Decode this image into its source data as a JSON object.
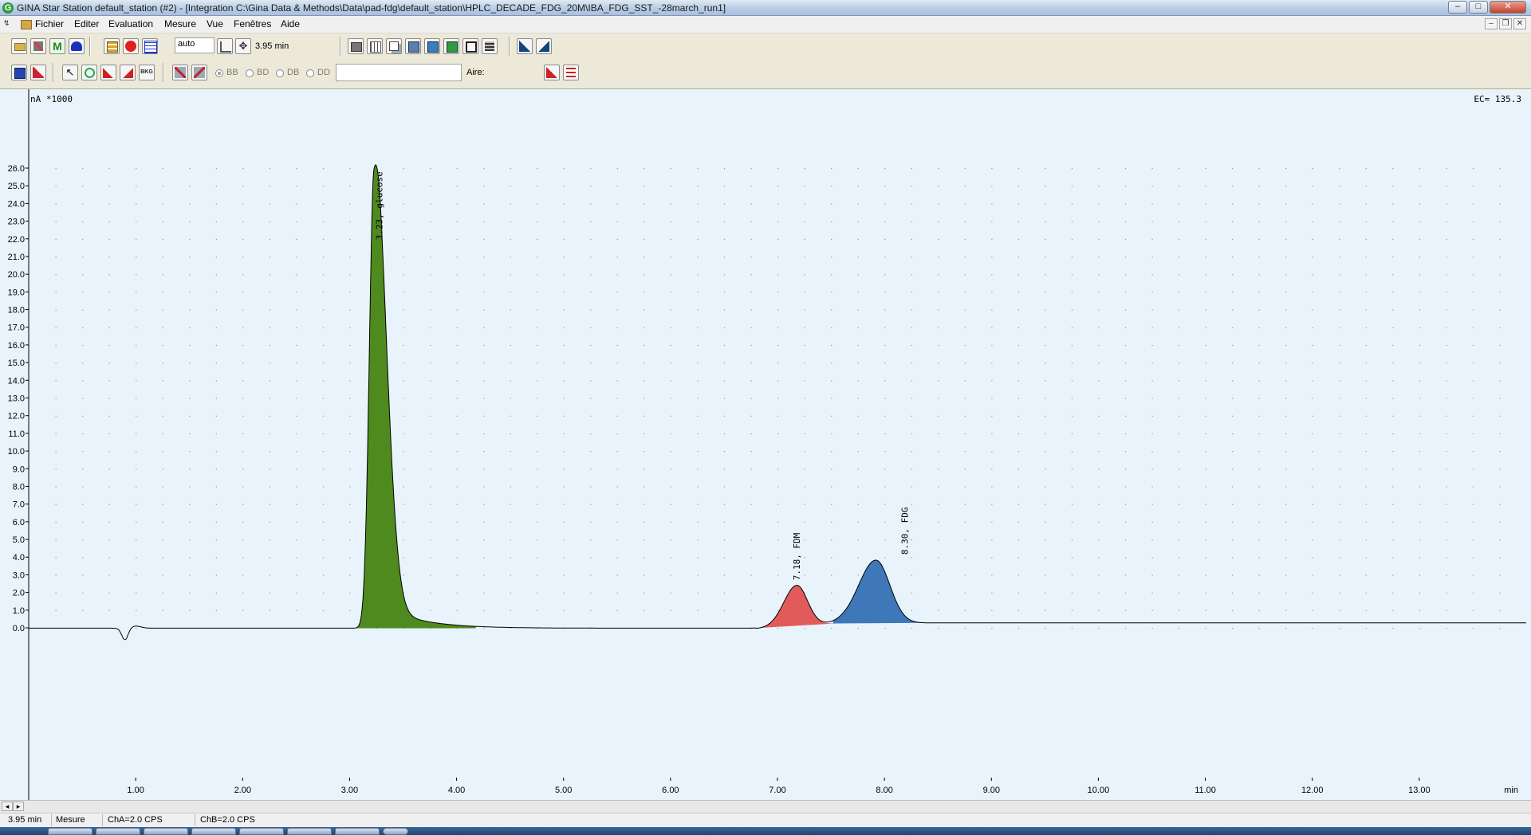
{
  "window": {
    "title": "GINA Star Station default_station (#2) - [Integration C:\\Gina Data & Methods\\Data\\pad-fdg\\default_station\\HPLC_DECADE_FDG_20M\\IBA_FDG_SST_-28march_run1]",
    "app_icon_letter": "G",
    "minimize": "–",
    "maximize": "□",
    "close": "✕"
  },
  "menu": {
    "items": [
      "Fichier",
      "Editer",
      "Evaluation",
      "Mesure",
      "Vue",
      "Fenêtres",
      "Aide"
    ],
    "mdi_minimize": "–",
    "mdi_restore": "❐",
    "mdi_close": "✕"
  },
  "toolbar": {
    "auto_value": "auto",
    "time_readout": "3.95 min",
    "radio_options": [
      "BB",
      "BD",
      "DB",
      "DD"
    ],
    "selected_radio": "BB",
    "area_label": "Aire:",
    "m_button_letter": "M",
    "bkg_label": "BKG"
  },
  "plot": {
    "y_unit": "nA *1000",
    "ec_readout": "EC= 135.3",
    "x_unit": "min",
    "background": "#e9f3fb"
  },
  "chart_data": {
    "type": "line",
    "title": "",
    "xlabel": "min",
    "ylabel": "nA *1000",
    "xlim": [
      0,
      14
    ],
    "ylim": [
      0,
      26
    ],
    "x_ticks": [
      "1.00",
      "2.00",
      "3.00",
      "4.00",
      "5.00",
      "6.00",
      "7.00",
      "8.00",
      "9.00",
      "10.00",
      "11.00",
      "12.00",
      "13.00"
    ],
    "y_ticks": [
      "0.0",
      "1.0",
      "2.0",
      "3.0",
      "4.0",
      "5.0",
      "6.0",
      "7.0",
      "8.0",
      "9.0",
      "10.0",
      "11.0",
      "12.0",
      "13.0",
      "14.0",
      "15.0",
      "16.0",
      "17.0",
      "18.0",
      "19.0",
      "20.0",
      "21.0",
      "22.0",
      "23.0",
      "24.0",
      "25.0",
      "26.0"
    ],
    "grid": true,
    "peaks": [
      {
        "label": "3.23, glucose",
        "rt": 3.23,
        "height": 26.0,
        "color": "#4f8a1e"
      },
      {
        "label": "7.18, FDM",
        "rt": 7.18,
        "height": 2.3,
        "color": "#e25b5b"
      },
      {
        "label": "8.30, FDG",
        "rt": 7.92,
        "height": 3.55,
        "color": "#3f78b8"
      }
    ],
    "trace_color": "#000000",
    "dip": {
      "x": 0.9,
      "y": -0.65
    }
  },
  "statusbar": {
    "time": "3.95 min",
    "mode": "Mesure",
    "cha": "ChA=2.0 CPS",
    "chb": "ChB=2.0 CPS"
  },
  "scrollbar": {
    "left_arrow": "◂",
    "right_arrow": "▸"
  }
}
